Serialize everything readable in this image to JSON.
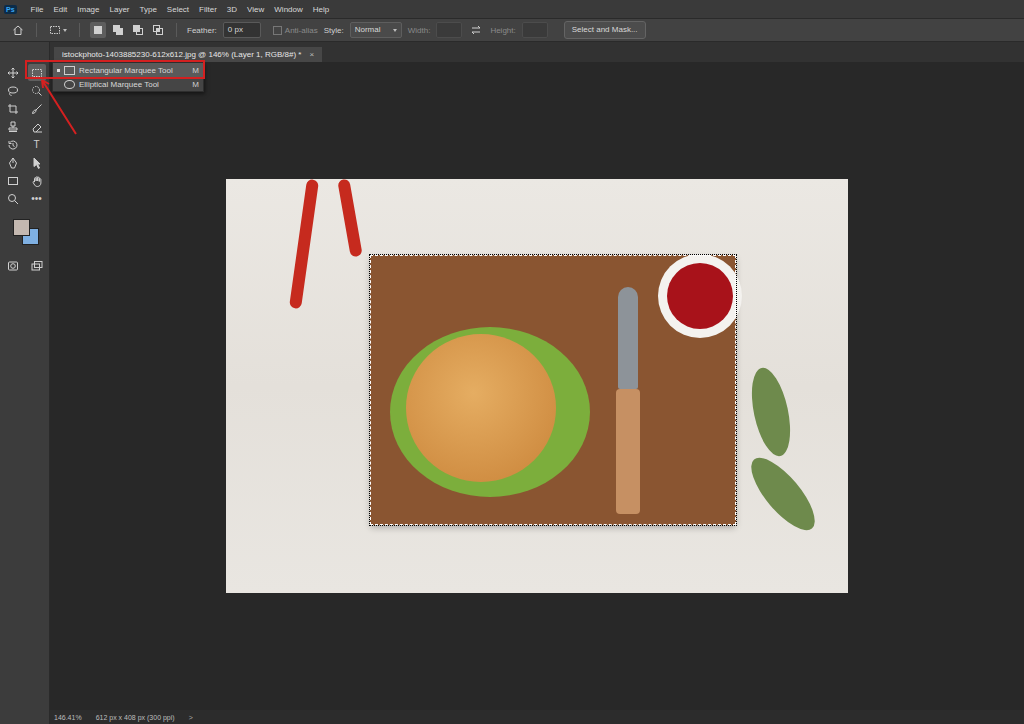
{
  "app": {
    "logo": "Ps"
  },
  "menu": [
    "File",
    "Edit",
    "Image",
    "Layer",
    "Type",
    "Select",
    "Filter",
    "3D",
    "View",
    "Window",
    "Help"
  ],
  "options_bar": {
    "modes": [
      {
        "selected": true
      },
      {
        "selected": false
      },
      {
        "selected": false
      },
      {
        "selected": false
      }
    ],
    "feather": {
      "label": "Feather:",
      "value": "0 px"
    },
    "anti_alias": {
      "label": "Anti-alias",
      "checked": false,
      "disabled": true
    },
    "style": {
      "label": "Style:",
      "value": "Normal"
    },
    "width": {
      "label": "Width:",
      "disabled": true
    },
    "height": {
      "label": "Height:",
      "disabled": true
    },
    "button": "Select and Mask..."
  },
  "document_tab": {
    "title": "istockphoto-1403885230-612x612.jpg @ 146% (Layer 1, RGB/8#) *",
    "close": "×",
    "selected": true
  },
  "tools": [
    {
      "selected": false
    },
    {
      "selected": true
    },
    {
      "selected": false
    },
    {
      "selected": false
    },
    {
      "selected": false
    },
    {
      "selected": false
    },
    {
      "selected": false
    },
    {
      "selected": false
    },
    {
      "selected": false
    },
    {
      "selected": false,
      "glyph": "T"
    },
    {
      "selected": false
    },
    {
      "selected": false
    },
    {
      "selected": false
    },
    {
      "selected": false
    },
    {
      "selected": false
    },
    {
      "selected": false,
      "glyph": "•••"
    },
    {
      "selected": false
    },
    {
      "selected": false
    }
  ],
  "swatches": [
    {
      "color": "#c4b8b0"
    },
    {
      "color": "#7fb0e2"
    }
  ],
  "flyout": [
    {
      "label": "Rectangular Marquee Tool",
      "shortcut": "M",
      "selected": true
    },
    {
      "label": "Elliptical Marquee Tool",
      "shortcut": "M",
      "selected": false
    }
  ],
  "status_bar": {
    "zoom": "146.41%",
    "document": "612 px x 408 px (300 ppi)",
    "arrow": ">"
  }
}
